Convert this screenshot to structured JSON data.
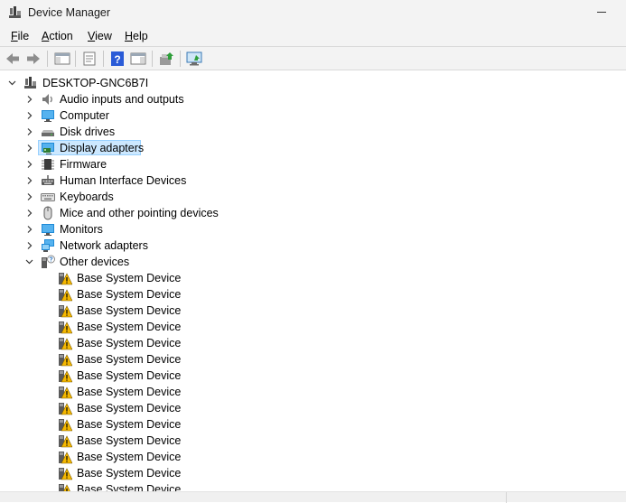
{
  "window": {
    "title": "Device Manager",
    "app_icon": "device-manager-icon"
  },
  "menu": {
    "items": [
      {
        "label_acc": "F",
        "label_rest": "ile"
      },
      {
        "label_acc": "A",
        "label_rest": "ction"
      },
      {
        "label_acc": "V",
        "label_rest": "iew"
      },
      {
        "label_acc": "H",
        "label_rest": "elp"
      }
    ]
  },
  "toolbar": {
    "buttons": [
      "back-arrow-icon",
      "forward-arrow-icon",
      "show-hide-console-tree-icon",
      "properties-icon",
      "help-icon",
      "action-pane-icon",
      "update-driver-icon",
      "scan-hardware-icon"
    ]
  },
  "tree": {
    "root": "DESKTOP-GNC6B7I",
    "categories": [
      {
        "label": "Audio inputs and outputs",
        "icon": "speaker-icon"
      },
      {
        "label": "Computer",
        "icon": "monitor-icon"
      },
      {
        "label": "Disk drives",
        "icon": "disk-drive-icon"
      },
      {
        "label": "Display adapters",
        "icon": "display-adapter-icon",
        "selected": true
      },
      {
        "label": "Firmware",
        "icon": "chip-icon"
      },
      {
        "label": "Human Interface Devices",
        "icon": "hid-icon"
      },
      {
        "label": "Keyboards",
        "icon": "keyboard-icon"
      },
      {
        "label": "Mice and other pointing devices",
        "icon": "mouse-icon"
      },
      {
        "label": "Monitors",
        "icon": "monitor-icon"
      },
      {
        "label": "Network adapters",
        "icon": "network-icon"
      },
      {
        "label": "Other devices",
        "icon": "unknown-device-icon",
        "expanded": true
      }
    ],
    "other_devices": [
      "Base System Device",
      "Base System Device",
      "Base System Device",
      "Base System Device",
      "Base System Device",
      "Base System Device",
      "Base System Device",
      "Base System Device",
      "Base System Device",
      "Base System Device",
      "Base System Device",
      "Base System Device",
      "Base System Device",
      "Base System Device"
    ]
  },
  "colors": {
    "selection_bg": "#cce8ff",
    "selection_border": "#99d1ff",
    "warning": "#f5b800",
    "chrome_bg": "#f3f3f3"
  }
}
